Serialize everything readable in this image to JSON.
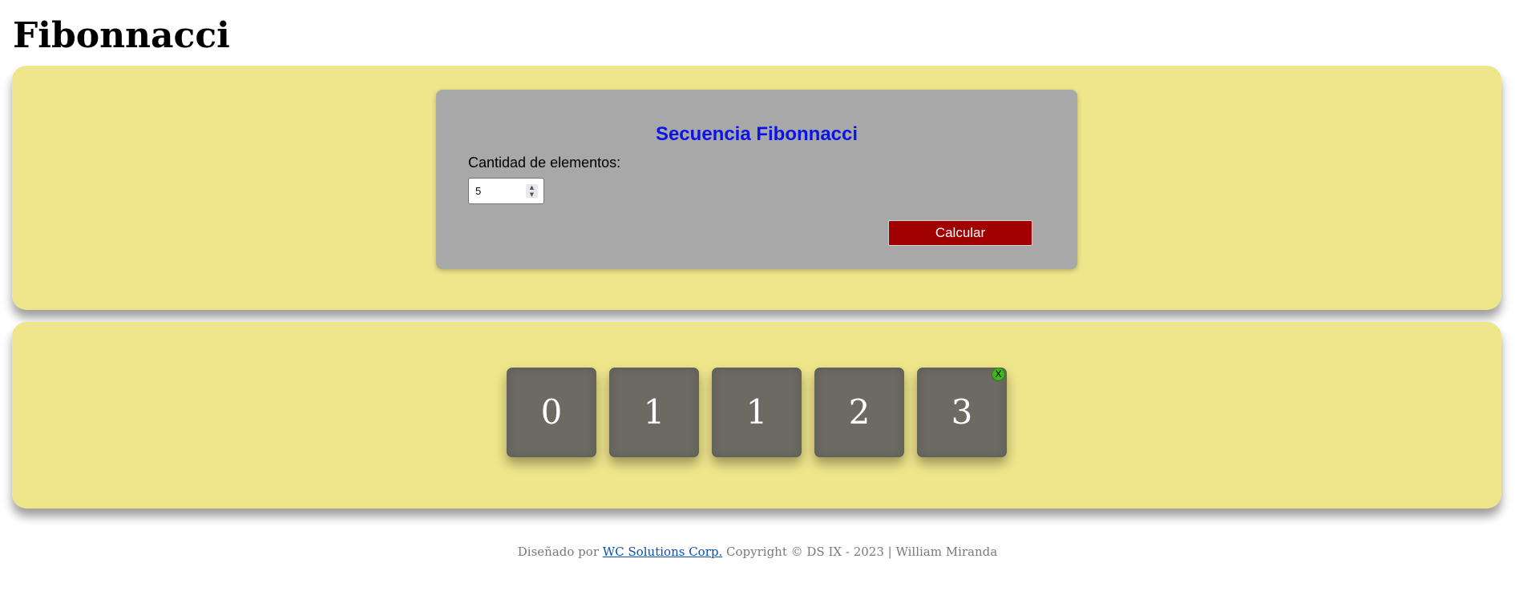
{
  "page": {
    "title": "Fibonnacci"
  },
  "form": {
    "title": "Secuencia Fibonnacci",
    "label": "Cantidad de elementos:",
    "input_value": "5",
    "button_label": "Calcular"
  },
  "results": {
    "values": [
      "0",
      "1",
      "1",
      "2",
      "3"
    ],
    "close_label": "X"
  },
  "footer": {
    "prefix": "Diseñado por",
    "link_text": "WC Solutions Corp.",
    "suffix": "Copyright © DS IX - 2023 | William Miranda"
  },
  "colors": {
    "panel_background": "#efe58b",
    "form_background": "#a8a8a8",
    "form_title": "#0a14e8",
    "button_background": "#a00000",
    "tile_background": "#6c6b63",
    "close_badge": "#3fb61f",
    "footer_link": "#0a4fb5"
  },
  "icons": {
    "spinner": "spinner-arrows-icon",
    "close": "close-icon"
  }
}
